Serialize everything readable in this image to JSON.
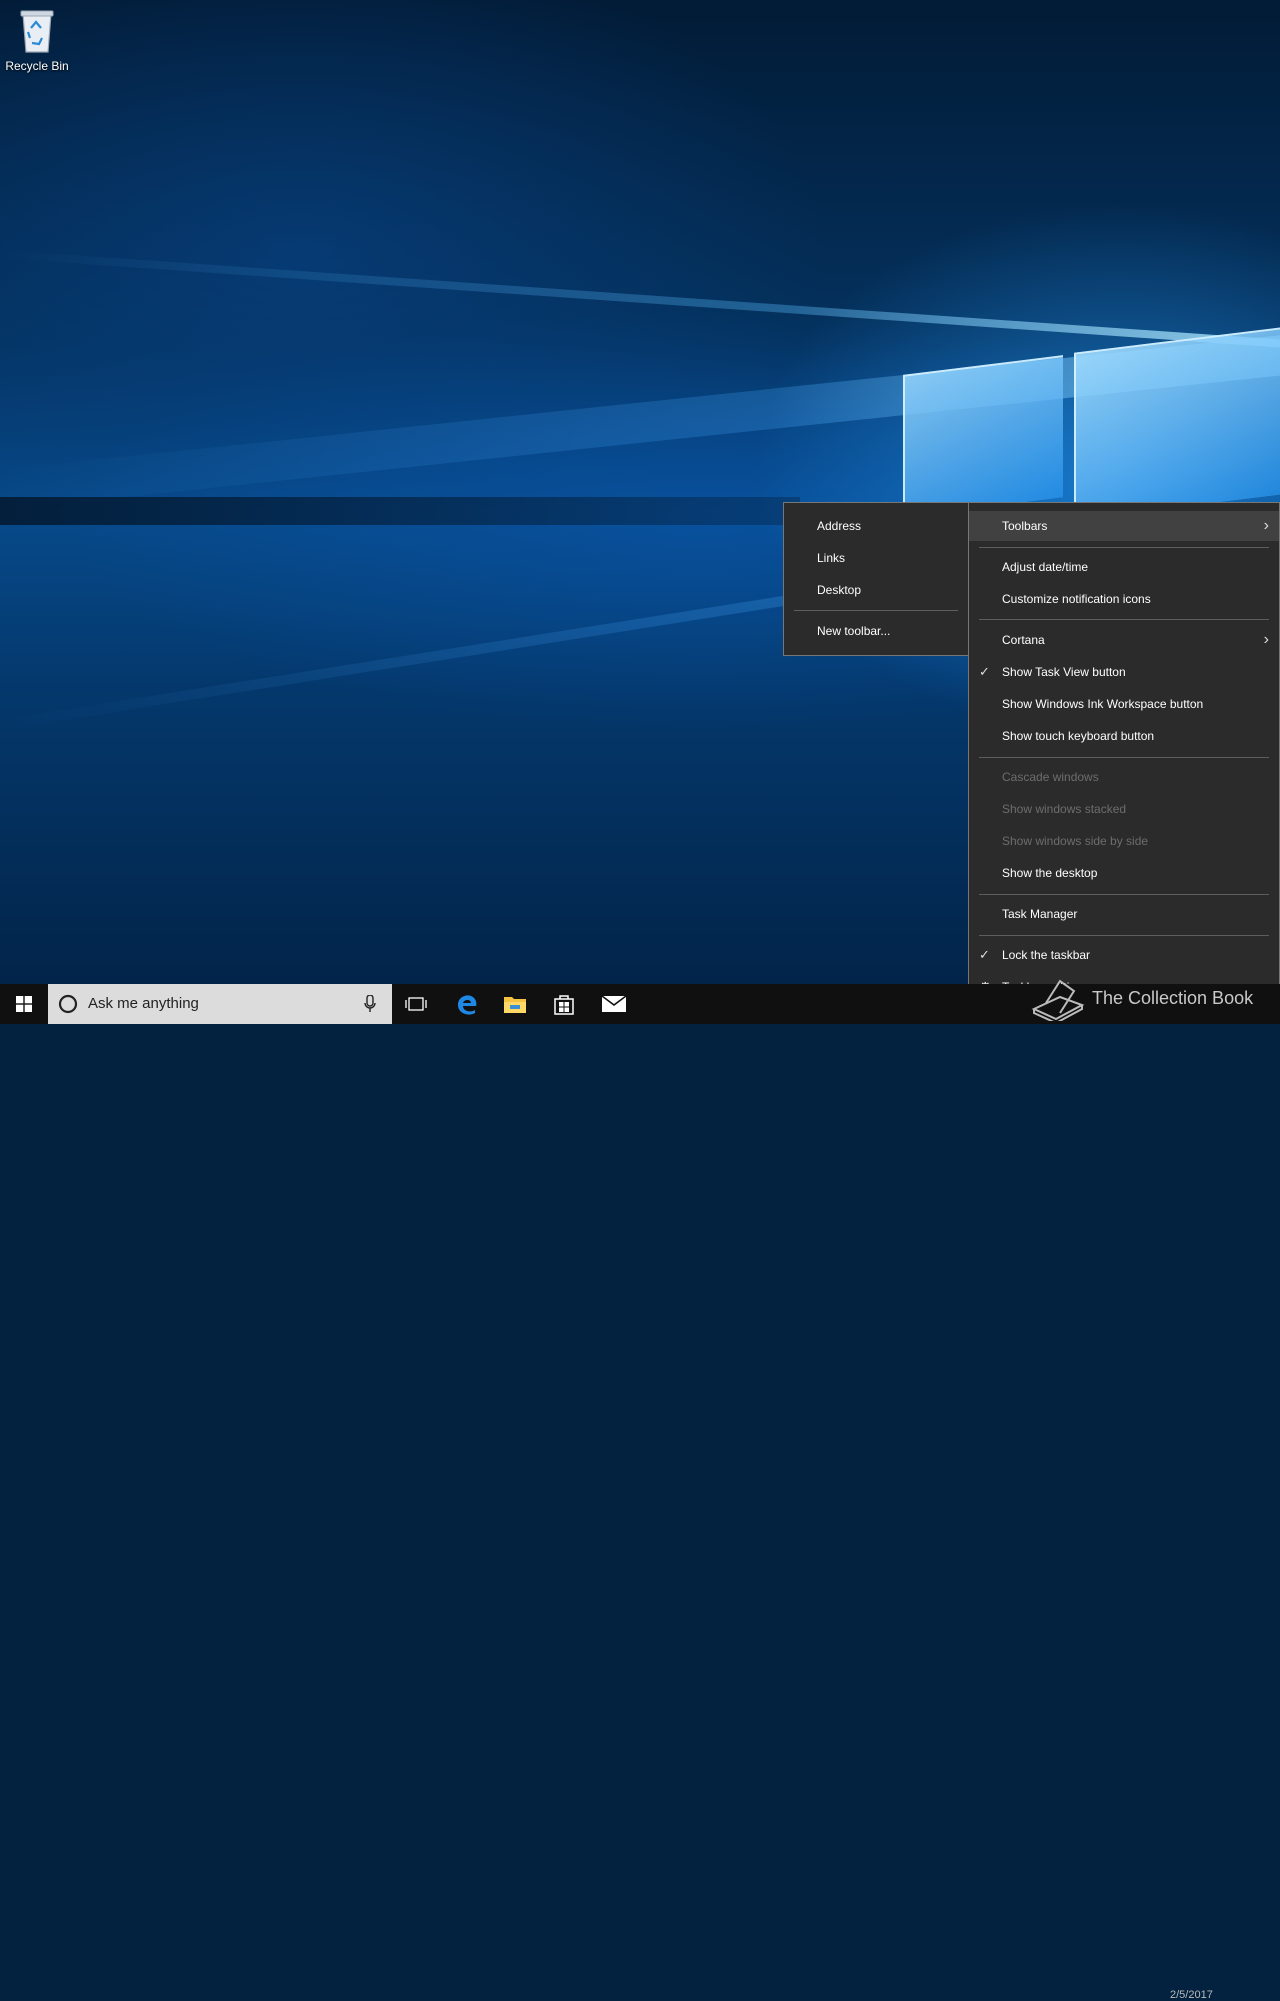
{
  "desktop": {
    "recycle_bin_label": "Recycle Bin"
  },
  "toolbars_submenu": {
    "items": [
      {
        "label": "Address"
      },
      {
        "label": "Links"
      },
      {
        "label": "Desktop"
      },
      {
        "label": "New toolbar..."
      }
    ]
  },
  "taskbar_menu": {
    "toolbars": "Toolbars",
    "adjust_datetime": "Adjust date/time",
    "customize_icons": "Customize notification icons",
    "cortana": "Cortana",
    "show_task_view": "Show Task View button",
    "show_ink": "Show Windows Ink Workspace button",
    "show_touch_keyboard": "Show touch keyboard button",
    "cascade": "Cascade windows",
    "stacked": "Show windows stacked",
    "side_by_side": "Show windows side by side",
    "show_desktop": "Show the desktop",
    "task_manager": "Task Manager",
    "lock_taskbar": "Lock the taskbar",
    "taskbar_settings": "Taskbar settings"
  },
  "taskbar": {
    "search_placeholder": "Ask me anything",
    "clock_date": "2/5/2017"
  },
  "watermark": {
    "text": "The Collection Book"
  },
  "colors": {
    "menu_bg": "#2b2b2b",
    "menu_highlight": "#414141",
    "taskbar_bg": "#101010",
    "accent_blue": "#1e88e5"
  }
}
